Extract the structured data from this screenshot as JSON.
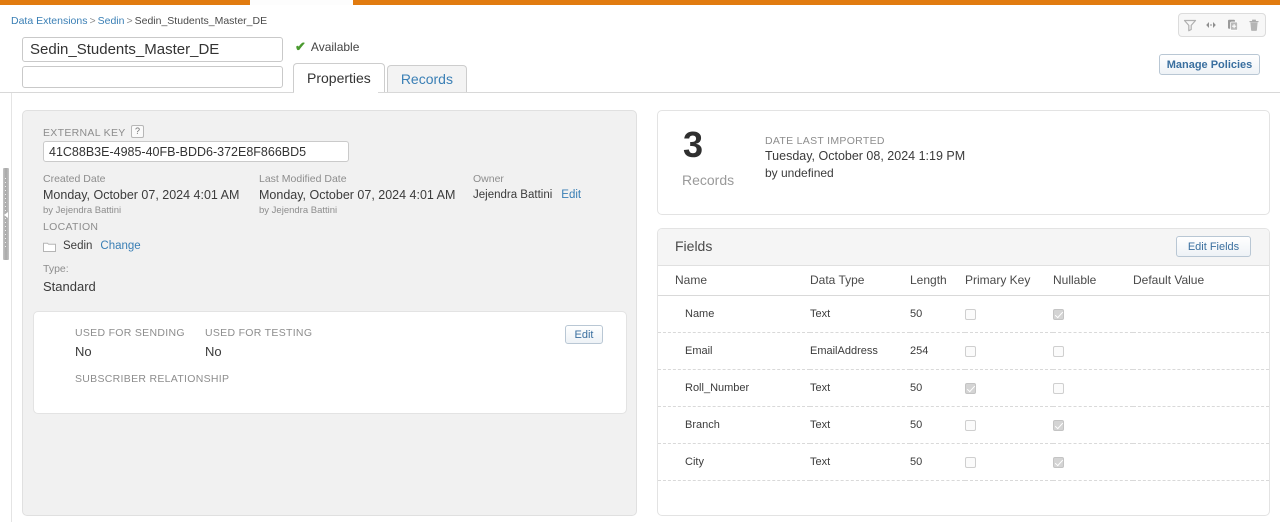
{
  "topbar": {
    "accent_color": "#e17b10"
  },
  "breadcrumb": {
    "root": "Data Extensions",
    "folder": "Sedin",
    "current": "Sedin_Students_Master_DE",
    "separator": ">"
  },
  "header": {
    "name_value": "Sedin_Students_Master_DE",
    "name_placeholder": "",
    "description_value": "",
    "description_placeholder": "",
    "status_text": "Available",
    "status_icon": "check-icon",
    "status_color": "#4a9a2f"
  },
  "tabs": [
    {
      "label": "Properties",
      "active": true
    },
    {
      "label": "Records",
      "active": false
    }
  ],
  "toolbar": {
    "icons": [
      {
        "name": "filter-icon",
        "title": "Filter"
      },
      {
        "name": "move-icon",
        "title": "Move"
      },
      {
        "name": "copy-icon",
        "title": "Copy"
      },
      {
        "name": "trash-icon",
        "title": "Delete"
      }
    ],
    "manage_policies_label": "Manage Policies"
  },
  "properties": {
    "external_key_label": "EXTERNAL KEY",
    "external_key_help": "?",
    "external_key_value": "41C88B3E-4985-40FB-BDD6-372E8F866BD5",
    "created": {
      "label": "Created Date",
      "value": "Monday, October 07, 2024 4:01 AM",
      "by": "by Jejendra Battini"
    },
    "modified": {
      "label": "Last Modified Date",
      "value": "Monday, October 07, 2024 4:01 AM",
      "by": "by Jejendra Battini"
    },
    "owner": {
      "label": "Owner",
      "name": "Jejendra Battini",
      "edit_label": "Edit"
    },
    "location": {
      "label": "LOCATION",
      "folder_icon": "folder-icon",
      "folder": "Sedin",
      "change_label": "Change"
    },
    "type": {
      "label": "Type:",
      "value": "Standard"
    }
  },
  "sending_card": {
    "used_for_sending_label": "USED FOR SENDING",
    "used_for_sending_value": "No",
    "used_for_testing_label": "USED FOR TESTING",
    "used_for_testing_value": "No",
    "subscriber_relationship_label": "SUBSCRIBER RELATIONSHIP",
    "edit_label": "Edit"
  },
  "records_panel": {
    "count": "3",
    "count_label": "Records",
    "date_last_imported_label": "DATE LAST IMPORTED",
    "date_last_imported_value": "Tuesday, October 08, 2024 1:19 PM",
    "date_last_imported_by": "by undefined"
  },
  "fields_panel": {
    "title": "Fields",
    "edit_fields_label": "Edit Fields",
    "columns": [
      "Name",
      "Data Type",
      "Length",
      "Primary Key",
      "Nullable",
      "Default Value"
    ],
    "rows": [
      {
        "name": "Name",
        "data_type": "Text",
        "length": "50",
        "primary_key": false,
        "nullable": true,
        "default_value": ""
      },
      {
        "name": "Email",
        "data_type": "EmailAddress",
        "length": "254",
        "primary_key": false,
        "nullable": false,
        "default_value": ""
      },
      {
        "name": "Roll_Number",
        "data_type": "Text",
        "length": "50",
        "primary_key": true,
        "nullable": false,
        "default_value": ""
      },
      {
        "name": "Branch",
        "data_type": "Text",
        "length": "50",
        "primary_key": false,
        "nullable": true,
        "default_value": ""
      },
      {
        "name": "City",
        "data_type": "Text",
        "length": "50",
        "primary_key": false,
        "nullable": true,
        "default_value": ""
      }
    ]
  }
}
